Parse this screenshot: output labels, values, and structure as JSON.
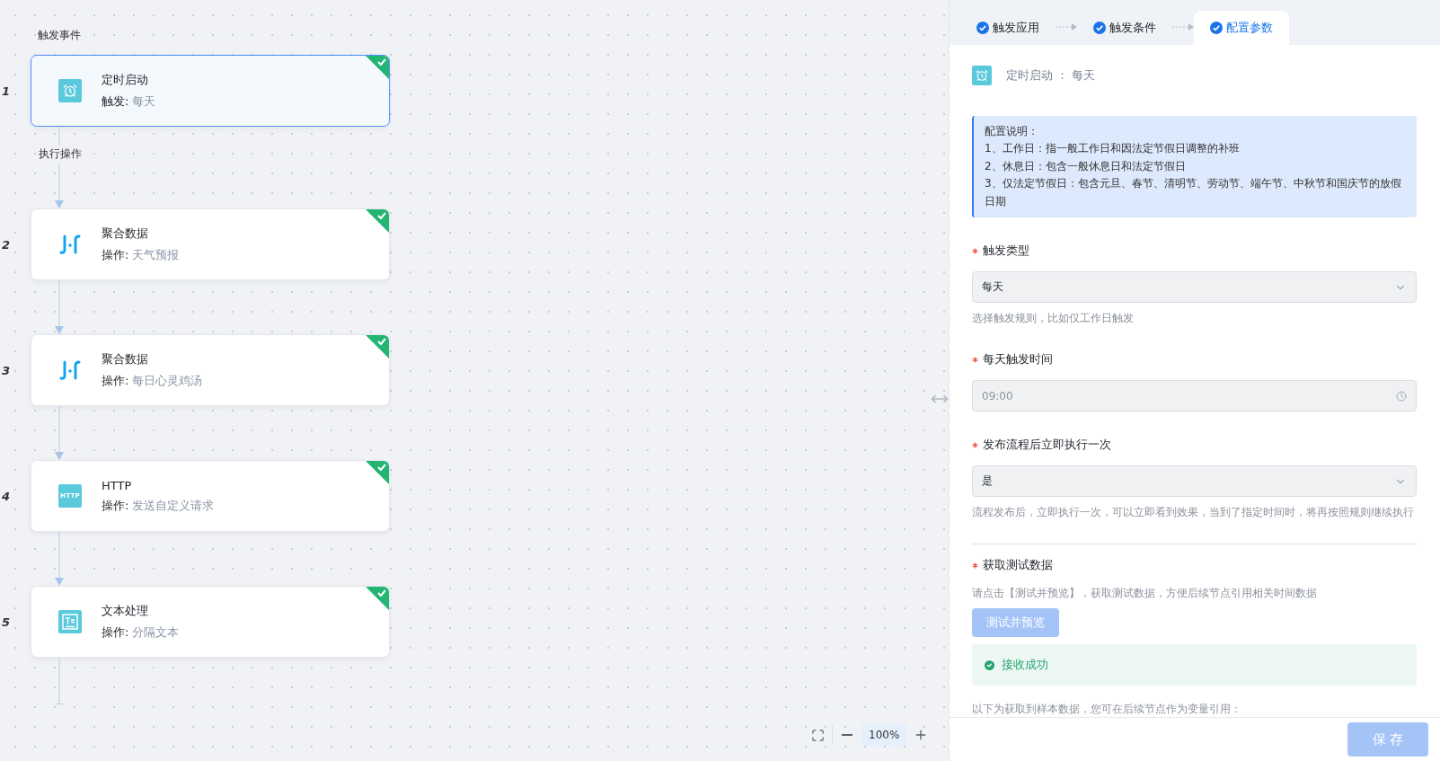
{
  "canvas": {
    "trigger_label": "触发事件",
    "action_label": "执行操作",
    "nodes": [
      {
        "index": "1",
        "kind": "clock",
        "title": "定时启动",
        "detail_label": "触发:",
        "detail": "每天",
        "selected": true,
        "done": true
      },
      {
        "index": "2",
        "kind": "aggregate",
        "title": "聚合数据",
        "detail_label": "操作:",
        "detail": "天气预报",
        "selected": false,
        "done": true
      },
      {
        "index": "3",
        "kind": "aggregate",
        "title": "聚合数据",
        "detail_label": "操作:",
        "detail": "每日心灵鸡汤",
        "selected": false,
        "done": true
      },
      {
        "index": "4",
        "kind": "http",
        "icon_label": "HTTP",
        "title": "HTTP",
        "detail_label": "操作:",
        "detail": "发送自定义请求",
        "selected": false,
        "done": true
      },
      {
        "index": "5",
        "kind": "text",
        "title": "文本处理",
        "detail_label": "操作:",
        "detail": "分隔文本",
        "selected": false,
        "done": true
      }
    ],
    "zoom": {
      "value": "100%"
    }
  },
  "panel": {
    "steps": [
      {
        "label": "触发应用",
        "done": true,
        "selected": false
      },
      {
        "label": "触发条件",
        "done": true,
        "selected": false
      },
      {
        "label": "配置参数",
        "done": true,
        "selected": true
      }
    ],
    "header": "定时启动 ： 每天",
    "info": {
      "title": "配置说明：",
      "lines": [
        "1、工作日：指一般工作日和因法定节假日调整的补班",
        "2、休息日：包含一般休息日和法定节假日",
        "3、仅法定节假日：包含元旦、春节、清明节、劳动节、端午节、中秋节和国庆节的放假日期"
      ]
    },
    "fields": [
      {
        "kind": "select",
        "label": "触发类型",
        "required": true,
        "value": "每天",
        "disabled": false,
        "help": "选择触发规则，比如仅工作日触发"
      },
      {
        "kind": "time",
        "label": "每天触发时间",
        "required": true,
        "value": "09:00",
        "disabled": true
      },
      {
        "kind": "select",
        "label": "发布流程后立即执行一次",
        "required": true,
        "value": "是",
        "disabled": false,
        "help": "流程发布后，立即执行一次，可以立即看到效果，当到了指定时间时，将再按照规则继续执行"
      }
    ],
    "test": {
      "label": "获取测试数据",
      "required": true,
      "help": "请点击【测试并预览】，获取测试数据，方便后续节点引用相关时间数据",
      "button": {
        "label": "测试并预览",
        "disabled": true
      },
      "result": {
        "success": true,
        "text": "接收成功"
      },
      "note": "以下为获取到样本数据，您可在后续节点作为变量引用："
    },
    "save": {
      "label": "保 存",
      "disabled": true
    }
  }
}
